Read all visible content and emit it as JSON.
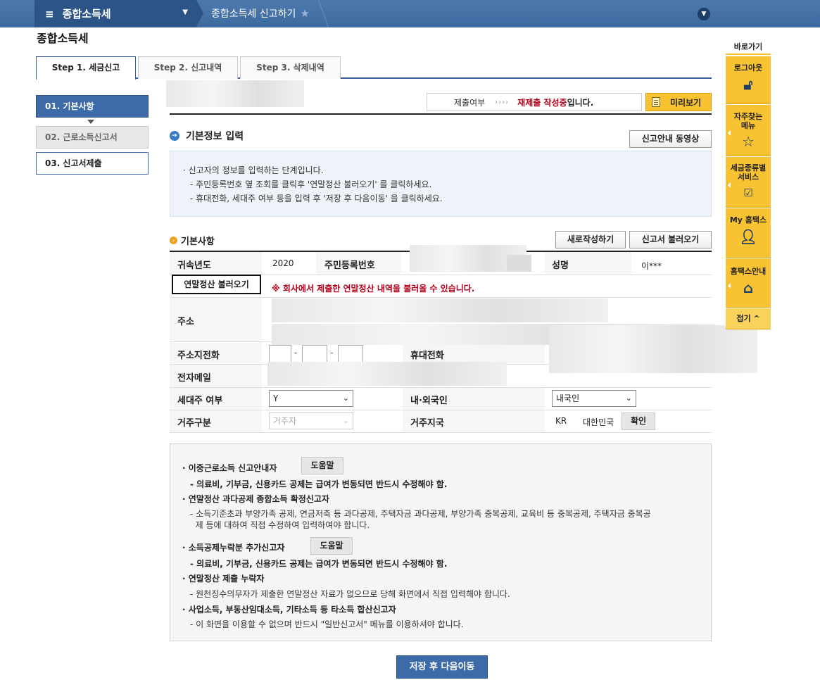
{
  "topbar": {
    "menu_title": "종합소득세",
    "breadcrumb": "종합소득세 신고하기"
  },
  "page_title": "종합소득세",
  "tabs": [
    {
      "label": "Step 1. 세금신고"
    },
    {
      "label": "Step 2. 신고내역"
    },
    {
      "label": "Step 3. 삭제내역"
    }
  ],
  "steps": [
    {
      "label": "01. 기본사항"
    },
    {
      "label": "02. 근로소득신고서"
    },
    {
      "label": "03. 신고서제출"
    }
  ],
  "status": {
    "label": "제출여부",
    "arrows": "››››",
    "value_red": "재제출 작성중",
    "value_suffix": "입니다.",
    "preview_button": "미리보기"
  },
  "section": {
    "title": "기본정보 입력",
    "video_button": "신고안내 동영상",
    "info": [
      "· 신고자의 정보를 입력하는 단계입니다.",
      "- 주민등록번호 옆 조회를 클릭후 '연말정산 불러오기' 를 클릭하세요.",
      "- 휴대전화, 세대주 여부 등을 입력 후 '저장 후 다음이동' 을 클릭하세요."
    ]
  },
  "basic": {
    "title": "기본사항",
    "new_button": "새로작성하기",
    "load_button": "신고서 불러오기",
    "year_label": "귀속년도",
    "year_value": "2020",
    "rrn_label": "주민등록번호",
    "name_label": "성명",
    "name_value": "이***",
    "year_end_button": "연말정산 불러오기",
    "warning": "※ 회사에서 제출한 연말정산 내역을 불러올 수 있습니다.",
    "address_label": "주소",
    "phone_label": "주소지전화",
    "phone_dash": "-",
    "mobile_label": "휴대전화",
    "email_label": "전자메일",
    "householder_label": "세대주 여부",
    "householder_value": "Y",
    "nationality_label": "내·외국인",
    "nationality_value": "내국인",
    "residence_type_label": "거주구분",
    "residence_type_value": "거주자",
    "residence_country_label": "거주지국",
    "country_code": "KR",
    "country_name": "대한민국",
    "confirm_button": "확인"
  },
  "notice": {
    "help_label": "도움말",
    "items": [
      {
        "title": "· 이중근로소득 신고안내자",
        "desc": [
          "- 의료비, 기부금, 신용카드 공제는 급여가 변동되면 반드시 수정해야 함."
        ]
      },
      {
        "title": "· 연말정산 과다공제 종합소득 확정신고자",
        "desc": [
          "- 소득기준초과 부양가족 공제, 연금저축 등 과다공제, 주택자금 과다공제, 부양가족 중복공제, 교육비 등 중복공제, 주택자금 중복공",
          "  제 등에 대하여 직접 수정하여 입력하여야 합니다."
        ]
      },
      {
        "title": "· 소득공제누락분 추가신고자",
        "desc": [
          "- 의료비, 기부금, 신용카드 공제는 급여가 변동되면 반드시 수정해야 함."
        ]
      },
      {
        "title": "· 연말정산 제출 누락자",
        "desc": [
          "- 원천징수의무자가 제출한 연말정산 자료가 없으므로 당해 화면에서 직접 입력해야 합니다."
        ]
      },
      {
        "title": "· 사업소득, 부동산임대소득, 기타소득 등 타소득 합산신고자",
        "desc": [
          "- 이 화면을 이용할 수 없으며 반드시 \"일반신고서\" 메뉴를 이용하셔야 합니다."
        ]
      }
    ]
  },
  "save_button": "저장 후 다음이동",
  "quick_menu": {
    "title": "바로가기",
    "items": [
      {
        "label": "로그아웃",
        "icon": "lock-icon"
      },
      {
        "label": "자주찾는\n메뉴",
        "icon": "star-icon"
      },
      {
        "label": "세금종류별\n서비스",
        "icon": "checkbox-icon"
      },
      {
        "label": "My 홈택스",
        "icon": "person-icon"
      },
      {
        "label": "홈택스안내",
        "icon": "house-icon"
      }
    ],
    "close_label": "접기 ^"
  }
}
